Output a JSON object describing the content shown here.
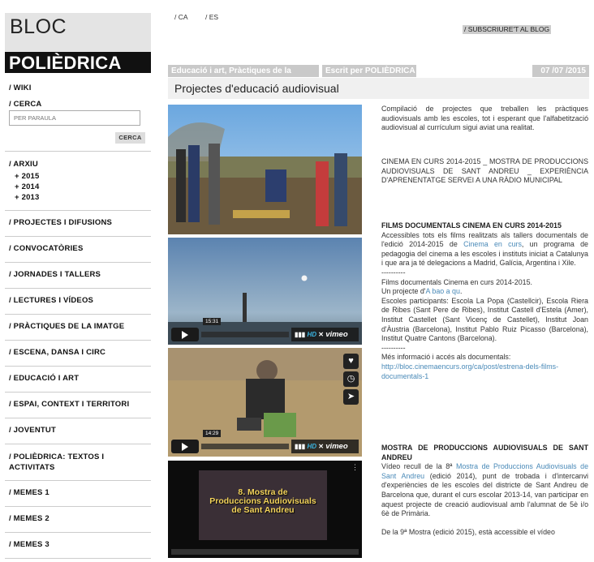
{
  "brand": {
    "line1": "BLOC",
    "line2": "POLIÈDRICA"
  },
  "lang": {
    "ca": "/ CA",
    "es": "/ ES"
  },
  "subscribe_label": "/ SUBSCRIURE'T AL BLOG",
  "sidebar": {
    "wiki": "/ WIKI",
    "search_label": "/ CERCA",
    "search_placeholder": "PER PARAULA",
    "search_button": "CERCA",
    "archive": "/ ARXIU",
    "years": [
      "+ 2015",
      "+ 2014",
      "+ 2013"
    ],
    "items": [
      "/ PROJECTES I DIFUSIONS",
      "/ CONVOCATÒRIES",
      "/ JORNADES I TALLERS",
      "/ LECTURES I VÍDEOS",
      "/ PRÀCTIQUES DE LA IMATGE",
      "/ ESCENA, DANSA I CIRC",
      "/ EDUCACIÓ I ART",
      "/ ESPAI, CONTEXT I TERRITORI",
      "/ JOVENTUT",
      "/ POLIÈDRICA: TEXTOS I ACTIVITATS",
      "/ MEMES 1",
      "/ MEMES 2",
      "/ MEMES 3"
    ]
  },
  "post": {
    "categories": "Educació i art, Pràctiques de la imatge",
    "author": "Escrit per POLIÈDRICA",
    "date": "07 /07 /2015",
    "title": "Projectes d'educació audiovisual"
  },
  "videos": [
    {
      "time": "15:31",
      "hd": "HD",
      "brand": "vimeo"
    },
    {
      "time": "14:29",
      "hd": "HD",
      "brand": "vimeo"
    },
    {
      "title_line1": "8. Mostra de",
      "title_line2": "Produccions Audiovisuals",
      "title_line3": "de Sant Andreu"
    }
  ],
  "body": {
    "intro": "Compilació de projectes que treballen les pràctiques audiovisuals amb les escoles, tot i esperant que l'alfabetització audiovisual al currículum sigui aviat una realitat.",
    "summary": "CINEMA EN CURS 2014-2015 _ MOSTRA DE PRODUCCIONS AUDIOVISUALS DE SANT ANDREU _ EXPERIÈNCIA D'APRENENTATGE SERVEI A UNA RÀDIO MUNICIPAL",
    "s1_heading": "FILMS DOCUMENTALS CINEMA EN CURS 2014-2015",
    "s1_p1a": "Accessibles tots els films realitzats als tallers documentals de l'edició 2014-2015 de ",
    "s1_link1": "Cinema en curs",
    "s1_p1b": ", un programa de pedagogia del cinema a les escoles i instituts iniciat a Catalunya i que ara ja té delegacions a Madrid, Galícia, Argentina i Xile.",
    "dash1": "----------",
    "s1_p2": "Films documentals Cinema en curs 2014-2015.",
    "s1_p3a": "Un projecte d'",
    "s1_link2": "A bao a qu",
    "s1_p3b": ".",
    "s1_p4": "Escoles participants: Escola La Popa (Castellcir), Escola Riera de Ribes (Sant Pere de Ribes), Institut Castell d'Estela (Amer), Institut Castellet (Sant Vicenç de Castellet), Institut Joan d'Àustria (Barcelona), Institut Pablo Ruiz Picasso (Barcelona), Institut Quatre Cantons (Barcelona).",
    "dash2": "----------",
    "s1_p5": "Més informació i accés als documentals:",
    "s1_url": "http://bloc.cinemaencurs.org/ca/post/estrena-dels-films-documentals-1",
    "s2_heading": "MOSTRA DE PRODUCCIONS AUDIOVISUALS DE SANT ANDREU",
    "s2_p1a": "Vídeo recull de la 8ª ",
    "s2_link": "Mostra de Produccions Audiovisuals de Sant Andreu",
    "s2_p1b": " (edició 2014), punt de trobada i d'intercanvi d'experiències de les escoles del districte de Sant Andreu de Barcelona que, durant el curs escolar 2013-14, van participar en aquest projecte de creació audiovisual amb l'alumnat de 5è i/o 6è de Primària.",
    "s2_p2": "De la 9ª Mostra (edició 2015), està accessible el vídeo"
  }
}
